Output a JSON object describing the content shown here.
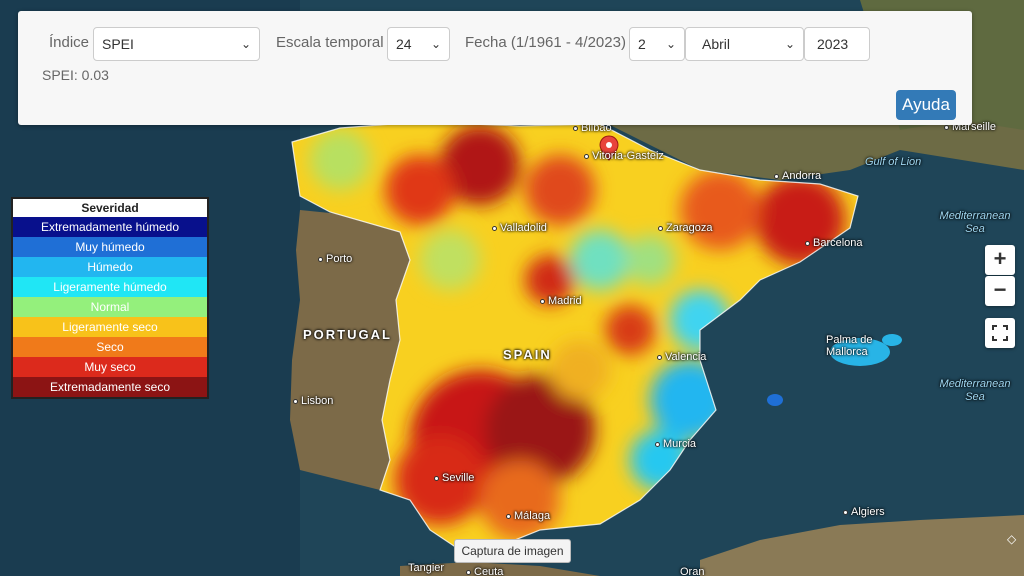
{
  "controls": {
    "indice_label": "Índice",
    "indice_value": "SPEI",
    "escala_label": "Escala temporal",
    "escala_value": "24",
    "fecha_label": "Fecha (1/1961 - 4/2023)",
    "fecha_day": "2",
    "fecha_month": "Abril",
    "fecha_year": "2023",
    "value_text": "SPEI: 0.03",
    "help_label": "Ayuda"
  },
  "legend": {
    "title": "Severidad",
    "items": [
      {
        "label": "Extremadamente húmedo",
        "color": "#08108c"
      },
      {
        "label": "Muy húmedo",
        "color": "#1f6fd6"
      },
      {
        "label": "Húmedo",
        "color": "#22b6f0"
      },
      {
        "label": "Ligeramente húmedo",
        "color": "#20e6f5"
      },
      {
        "label": "Normal",
        "color": "#94f07c"
      },
      {
        "label": "Ligeramente seco",
        "color": "#f8c21a"
      },
      {
        "label": "Seco",
        "color": "#f07a1a"
      },
      {
        "label": "Muy seco",
        "color": "#dc2a1c"
      },
      {
        "label": "Extremadamente seco",
        "color": "#8c1414"
      }
    ]
  },
  "map_labels": {
    "portugal": "PORTUGAL",
    "spain": "SPAIN",
    "bilbao": "Bilbao",
    "vitoria": "Vitoria-Gasteiz",
    "andorra": "Andorra",
    "marseille": "Marseille",
    "gulf_lion": "Gulf of Lion",
    "med1": "Mediterranean Sea",
    "med2": "Mediterranean Sea",
    "valladolid": "Valladolid",
    "zaragoza": "Zaragoza",
    "barcelona": "Barcelona",
    "porto": "Porto",
    "madrid": "Madrid",
    "valencia": "Valencia",
    "palma": "Palma de Mallorca",
    "lisbon": "Lisbon",
    "murcia": "Murcia",
    "seville": "Seville",
    "malaga": "Málaga",
    "algiers": "Algiers",
    "tangier": "Tangier",
    "ceuta": "Ceuta",
    "oran": "Oran"
  },
  "zoom": {
    "in": "+",
    "out": "−"
  },
  "capture_label": "Captura de imagen",
  "colors": {
    "accent": "#337ab7",
    "sea": "#1e3f52",
    "land": "#6b6a4a"
  }
}
